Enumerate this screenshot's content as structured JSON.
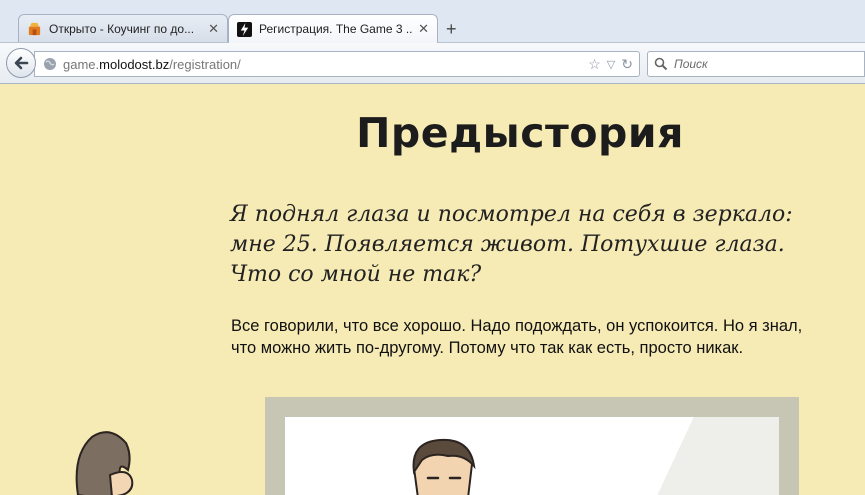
{
  "browser": {
    "tabs": [
      {
        "title": "Открыто - Коучинг по до...",
        "active": false,
        "close": "✕"
      },
      {
        "title": "Регистрация. The Game 3 ...",
        "active": true,
        "close": "✕"
      }
    ],
    "new_tab_label": "+",
    "url": {
      "prefix": "game.",
      "host": "molodost.bz",
      "path": "/registration/"
    },
    "search": {
      "placeholder": "Поиск"
    }
  },
  "page": {
    "heading": "Предыстория",
    "quote_lines": [
      "Я поднял глаза и посмотрел на себя в зеркало:",
      "мне 25. Появляется живот. Потухшие глаза.",
      "Что со мной не так?"
    ],
    "body_lines": [
      "Все говорили, что все хорошо. Надо подождать, он успокоится. Но я знал,",
      "что можно жить по-другому. Потому что так как есть, просто никак."
    ]
  },
  "colors": {
    "page_background": "#f6eab5",
    "heading_text": "#1c1c1c",
    "frame": "#c7c5b4",
    "tabstrip": "#dfe7f2"
  },
  "icons": [
    "store-favicon-icon",
    "lightning-favicon-icon",
    "close-icon",
    "back-arrow-icon",
    "globe-icon",
    "star-icon",
    "dropdown-icon",
    "reload-icon",
    "search-icon"
  ]
}
